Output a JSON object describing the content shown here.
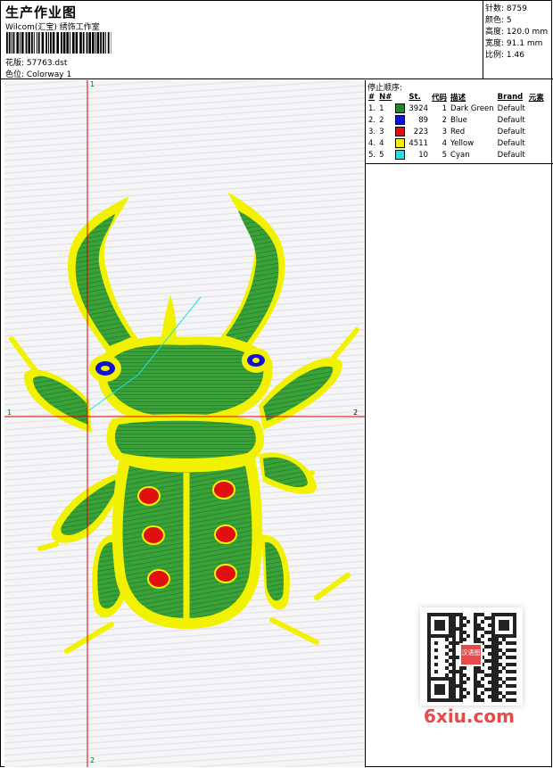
{
  "header": {
    "title": "生产作业图",
    "company": "Wilcom(汇宝) 绣饰工作室",
    "design_label": "花版:",
    "design_value": "57763.dst",
    "colorway_label": "色位:",
    "colorway_value": "Colorway 1"
  },
  "stats": {
    "stitches_label": "针数:",
    "stitches_value": "8759",
    "colors_label": "颜色:",
    "colors_value": "5",
    "height_label": "高度:",
    "height_value": "120.0 mm",
    "width_label": "宽度:",
    "width_value": "91.1 mm",
    "scale_label": "比例:",
    "scale_value": "1.46"
  },
  "markers": {
    "top": "1",
    "bottom": "2",
    "left": "1",
    "right": "2"
  },
  "stop_sequence": {
    "title": "停止顺序:",
    "columns": [
      "#",
      "N#",
      "St.",
      "代码",
      "描述",
      "Brand",
      "元素"
    ],
    "rows": [
      {
        "idx": "1.",
        "n": "1",
        "color": "#1e8c1e",
        "st": "3924",
        "code": "1",
        "desc": "Dark Green",
        "brand": "Default"
      },
      {
        "idx": "2.",
        "n": "2",
        "color": "#1010d8",
        "st": "89",
        "code": "2",
        "desc": "Blue",
        "brand": "Default"
      },
      {
        "idx": "3.",
        "n": "3",
        "color": "#e01010",
        "st": "223",
        "code": "3",
        "desc": "Red",
        "brand": "Default"
      },
      {
        "idx": "4.",
        "n": "4",
        "color": "#f0f000",
        "st": "4511",
        "code": "4",
        "desc": "Yellow",
        "brand": "Default"
      },
      {
        "idx": "5.",
        "n": "5",
        "color": "#20e0e0",
        "st": "10",
        "code": "5",
        "desc": "Cyan",
        "brand": "Default"
      }
    ]
  },
  "watermark": {
    "qr_badge": "汉语图",
    "site": "6xiu.com"
  },
  "colors": {
    "guide_line": "#e00000",
    "stitch_yellow": "#f2f200",
    "stitch_green": "#2e9a2e",
    "stitch_blue": "#1010d8",
    "stitch_red": "#e01010",
    "stitch_cyan": "#20e0e0"
  }
}
